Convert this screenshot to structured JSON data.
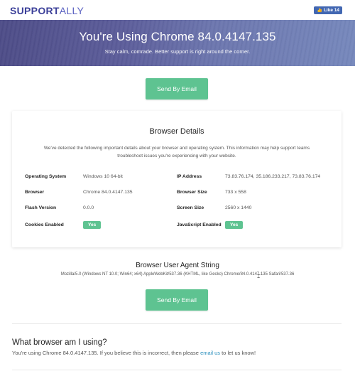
{
  "header": {
    "logo_support": "SUPPORT",
    "logo_ally": "ALLY",
    "fb_like": "Like 14"
  },
  "hero": {
    "title": "You're Using Chrome 84.0.4147.135",
    "subtitle": "Stay calm, comrade. Better support is right around the corner."
  },
  "buttons": {
    "send_email": "Send By Email"
  },
  "card": {
    "title": "Browser Details",
    "description_line1": "We've detected the following important details about your browser and operating system. This information may help support teams",
    "description_line2": "troubleshoot issues you're experiencing with your website.",
    "left": [
      {
        "label": "Operating System",
        "value": "Windows 10 64-bit"
      },
      {
        "label": "Browser",
        "value": "Chrome 84.0.4147.135"
      },
      {
        "label": "Flash Version",
        "value": "0.0.0"
      },
      {
        "label": "Cookies Enabled",
        "value": "Yes"
      }
    ],
    "right": [
      {
        "label": "IP Address",
        "value": "73.83.76.174, 35.186.233.217, 73.83.76.174"
      },
      {
        "label": "Browser Size",
        "value": "733 x 558"
      },
      {
        "label": "Screen Size",
        "value": "2560 x 1440"
      },
      {
        "label": "JavaScript Enabled",
        "value": "Yes"
      }
    ]
  },
  "ua": {
    "title": "Browser User Agent String",
    "string": "Mozilla/5.0 (Windows NT 10.0; Win64; x64) AppleWebKit/537.36 (KHTML, like Gecko) Chrome/84.0.4147.135 Safari/537.36"
  },
  "faq": {
    "heading": "What browser am I using?",
    "text_before": "You're using Chrome 84.0.4147.135. If you believe this is incorrect, then please ",
    "link": "email us",
    "text_after": " to let us know!"
  },
  "colors": {
    "accent_green": "#5ec391",
    "brand_purple": "#3b3f99",
    "link_blue": "#2a8fbd"
  }
}
